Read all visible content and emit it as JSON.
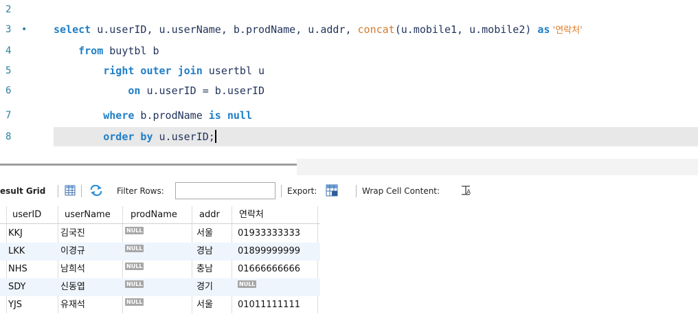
{
  "editor": {
    "lines": [
      {
        "num": "2",
        "marker": "",
        "segments": []
      },
      {
        "num": "3",
        "marker": "•",
        "segments": [
          {
            "t": "select",
            "c": "kw"
          },
          {
            "t": " u.userID, u.userName, b.prodName, u.addr, ",
            "c": ""
          },
          {
            "t": "concat",
            "c": "fn"
          },
          {
            "t": "(u.mobile1, u.mobile2) ",
            "c": ""
          },
          {
            "t": "as",
            "c": "kw"
          },
          {
            "t": " '연락처'",
            "c": "str"
          }
        ]
      },
      {
        "num": "4",
        "marker": "",
        "segments": [
          {
            "t": "    ",
            "c": ""
          },
          {
            "t": "from",
            "c": "kw"
          },
          {
            "t": " buytbl b",
            "c": ""
          }
        ]
      },
      {
        "num": "5",
        "marker": "",
        "segments": [
          {
            "t": "        ",
            "c": ""
          },
          {
            "t": "right outer join",
            "c": "kw"
          },
          {
            "t": " usertbl u",
            "c": ""
          }
        ]
      },
      {
        "num": "6",
        "marker": "",
        "segments": [
          {
            "t": "            ",
            "c": ""
          },
          {
            "t": "on",
            "c": "kw"
          },
          {
            "t": " u.userID = b.userID",
            "c": ""
          }
        ]
      },
      {
        "num": "7",
        "marker": "",
        "segments": [
          {
            "t": "        ",
            "c": ""
          },
          {
            "t": "where",
            "c": "kw"
          },
          {
            "t": " b.prodName ",
            "c": ""
          },
          {
            "t": "is null",
            "c": "kw"
          }
        ]
      },
      {
        "num": "8",
        "marker": "",
        "segments": [
          {
            "t": "        ",
            "c": ""
          },
          {
            "t": "order by",
            "c": "kw"
          },
          {
            "t": " u.userID;",
            "c": ""
          }
        ],
        "caret": true
      }
    ]
  },
  "toolbar": {
    "result_grid_label": "esult Grid",
    "filter_label": "Filter Rows:",
    "filter_value": "",
    "export_label": "Export:",
    "wrap_label": "Wrap Cell Content:"
  },
  "grid": {
    "columns": [
      "userID",
      "userName",
      "prodName",
      "addr",
      "연락처"
    ],
    "null_label": "NULL",
    "rows": [
      [
        "KKJ",
        "김국진",
        null,
        "서울",
        "01933333333"
      ],
      [
        "LKK",
        "이경규",
        null,
        "경남",
        "01899999999"
      ],
      [
        "NHS",
        "남희석",
        null,
        "충남",
        "01666666666"
      ],
      [
        "SDY",
        "신동엽",
        null,
        "경기",
        null
      ],
      [
        "YJS",
        "유재석",
        null,
        "서울",
        "01011111111"
      ]
    ]
  },
  "colors": {
    "keyword": "#1f7ec7",
    "function": "#d27a2a",
    "line_number": "#2a7f9c",
    "alt_row": "#eef5fd"
  }
}
